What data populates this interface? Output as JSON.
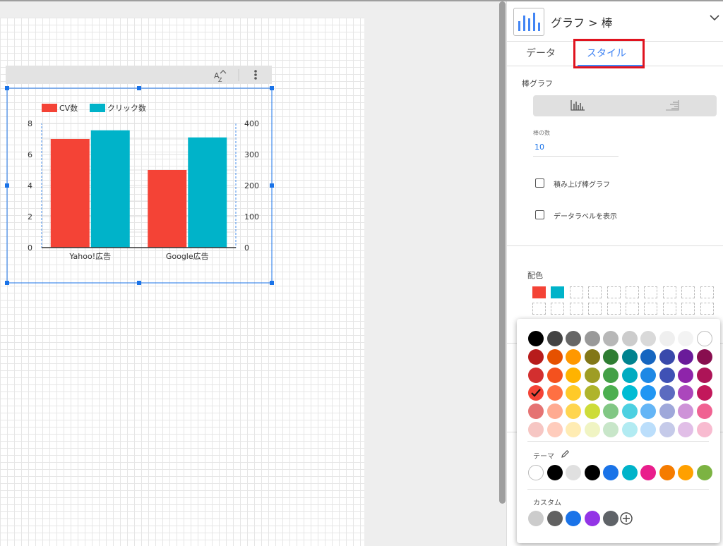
{
  "panel": {
    "title": "グラフ > 棒",
    "tabs": [
      {
        "label": "データ"
      },
      {
        "label": "スタイル"
      }
    ],
    "section_bar_chart": "棒グラフ",
    "bars_label": "棒の数",
    "bars_value": "10",
    "stacked_label": "積み上げ棒グラフ",
    "stacked_checked": false,
    "data_labels_label": "データラベルを表示",
    "data_labels_checked": false,
    "color_section": "配色",
    "selected_colors": [
      "#f44336",
      "#00b3c9"
    ]
  },
  "color_picker": {
    "grid": [
      [
        "#000000",
        "#434343",
        "#666666",
        "#999999",
        "#b7b7b7",
        "#cccccc",
        "#d9d9d9",
        "#efefef",
        "#f3f3f3",
        "#ffffff"
      ],
      [
        "#b71c1c",
        "#e65100",
        "#ff9800",
        "#827717",
        "#2e7d32",
        "#00838f",
        "#1565c0",
        "#3949ab",
        "#6a1b9a",
        "#880e4f"
      ],
      [
        "#d32f2f",
        "#f4511e",
        "#ffb300",
        "#9e9d24",
        "#43a047",
        "#00acc1",
        "#1e88e5",
        "#3f51b5",
        "#8e24aa",
        "#ad1457"
      ],
      [
        "#f44336",
        "#ff7043",
        "#ffca28",
        "#afb42b",
        "#4caf50",
        "#00bcd4",
        "#2196f3",
        "#5c6bc0",
        "#ab47bc",
        "#c2185b"
      ],
      [
        "#e57373",
        "#ffab91",
        "#ffd54f",
        "#cddc39",
        "#81c784",
        "#4dd0e1",
        "#64b5f6",
        "#9fa8da",
        "#ce93d8",
        "#f06292"
      ],
      [
        "#f6c6c3",
        "#ffccbc",
        "#ffecb3",
        "#f0f4c3",
        "#c8e6c9",
        "#b2ebf2",
        "#bbdefb",
        "#c5cae9",
        "#e1bee7",
        "#f8bbd0"
      ]
    ],
    "selected": [
      3,
      0
    ],
    "theme_label": "テーマ",
    "theme_colors": [
      "#ffffff",
      "#000000",
      "#e0e0e0",
      "#000000",
      "#1a73e8",
      "#00b3c9",
      "#e91e8c",
      "#f57c00",
      "#ffa000",
      "#7cb342"
    ],
    "custom_label": "カスタム",
    "custom_colors": [
      "#cccccc",
      "#616161",
      "#1a73e8",
      "#9334e6",
      "#5f6368"
    ]
  },
  "chart_data": {
    "type": "bar",
    "categories": [
      "Yahoo!広告",
      "Google広告"
    ],
    "series": [
      {
        "name": "CV数",
        "values": [
          7,
          5
        ],
        "color": "#f44336",
        "axis": "left"
      },
      {
        "name": "クリック数",
        "values": [
          378,
          355
        ],
        "color": "#00b3c9",
        "axis": "right"
      }
    ],
    "yticks_left": [
      "0",
      "2",
      "4",
      "6",
      "8"
    ],
    "yticks_right": [
      "0",
      "100",
      "200",
      "300",
      "400"
    ],
    "ylim_left": [
      0,
      8
    ],
    "ylim_right": [
      0,
      400
    ],
    "legend_position": "top-left",
    "grid": true
  }
}
